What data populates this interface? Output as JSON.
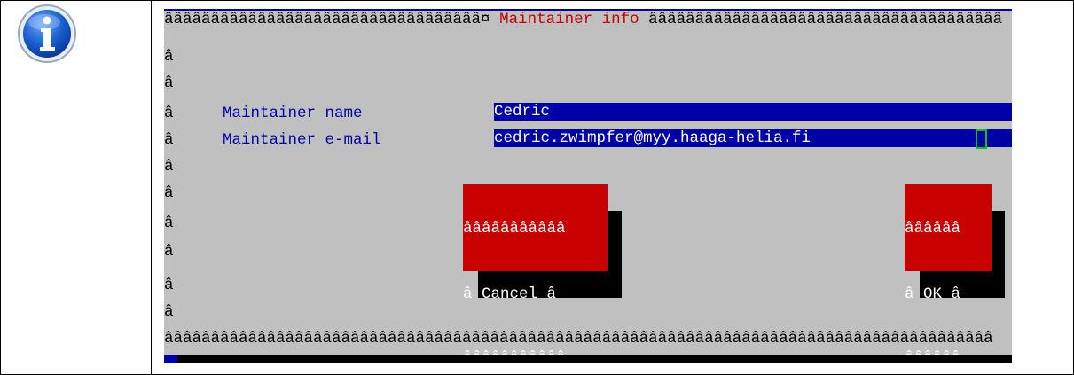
{
  "dialog": {
    "title_border_left": "ââââââââââââââââââââââââââââââââââ¤",
    "title": " Maintainer info ",
    "title_border_right": "ââââââââââââââââââââââââââââââââââââââ",
    "side_char": "â",
    "bottom_border": "âââââââââââââââââââââââââââââââââââââââââââââââââââââââââââââââââââââââââââââââââââââââââ"
  },
  "form": {
    "name_label": "Maintainer name",
    "name_value": "Cedric",
    "email_label": "Maintainer e-mail",
    "email_value": "cedric.zwimpfer@myy.haaga-helia.fi"
  },
  "buttons": {
    "cancel": {
      "top": "âââââââââââ",
      "label": "â Cancel â",
      "bottom": "âââââââââââ"
    },
    "ok": {
      "top": "ââââââ",
      "label": "â OK â",
      "bottom": "ââââââ"
    }
  },
  "colors": {
    "terminal_bg": "#c0c0c0",
    "accent_blue": "#0000a8",
    "button_red": "#c80000",
    "title_red": "#c80000",
    "cursor_green": "#10c010"
  },
  "icons": {
    "info": "info-icon"
  }
}
